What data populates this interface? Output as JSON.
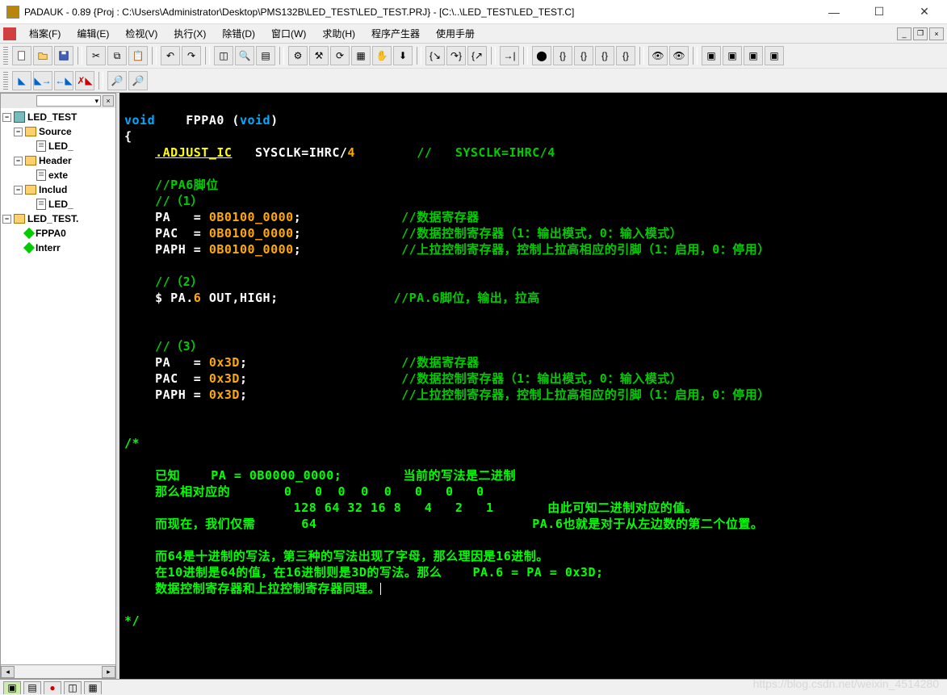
{
  "title": "PADAUK - 0.89 {Proj : C:\\Users\\Administrator\\Desktop\\PMS132B\\LED_TEST\\LED_TEST.PRJ} - [C:\\..\\LED_TEST\\LED_TEST.C]",
  "menu": {
    "file": "档案(F)",
    "edit": "编辑(E)",
    "view": "检视(V)",
    "run": "执行(X)",
    "debug": "除错(D)",
    "window": "窗口(W)",
    "help": "求助(H)",
    "codegen": "程序产生器",
    "manual": "使用手册"
  },
  "tree": {
    "root": "LED_TEST",
    "source": "Source",
    "source_file": "LED_",
    "header": "Header",
    "header_file": "exte",
    "include": "Includ",
    "include_file": "LED_",
    "prj": "LED_TEST.",
    "fn1": "FPPA0",
    "fn2": "Interr"
  },
  "code": {
    "l1a": "void",
    "l1b": "    FPPA0 (",
    "l1c": "void",
    "l1d": ")",
    "l2": "{",
    "l3a": "    ",
    "l3b": ".ADJUST_IC",
    "l3c": "   SYSCLK=IHRC/",
    "l3d": "4",
    "l3e": "        ",
    "l3f": "//   SYSCLK=IHRC/4",
    "l5": "    //PA6脚位",
    "l6": "    //（1）",
    "l7a": "    PA   = ",
    "l7b": "0B0100_0000",
    "l7c": ";",
    "l7pad": "             ",
    "l7d": "//数据寄存器",
    "l8a": "    PAC  = ",
    "l8b": "0B0100_0000",
    "l8c": ";",
    "l8pad": "             ",
    "l8d": "//数据控制寄存器（1：输出模式，0：输入模式）",
    "l9a": "    PAPH = ",
    "l9b": "0B0100_0000",
    "l9c": ";",
    "l9pad": "             ",
    "l9d": "//上拉控制寄存器，控制上拉高相应的引脚（1：启用，0：停用）",
    "l11": "    //（2）",
    "l12a": "    $ PA.",
    "l12b": "6",
    "l12c": " OUT,HIGH;",
    "l12pad": "               ",
    "l12d": "//PA.6脚位，输出，拉高",
    "l15": "    //（3）",
    "l16a": "    PA   = ",
    "l16b": "0x3D",
    "l16c": ";",
    "l16pad": "                    ",
    "l16d": "//数据寄存器",
    "l17a": "    PAC  = ",
    "l17b": "0x3D",
    "l17c": ";",
    "l17pad": "                    ",
    "l17d": "//数据控制寄存器（1：输出模式，0：输入模式）",
    "l18a": "    PAPH = ",
    "l18b": "0x3D",
    "l18c": ";",
    "l18pad": "                    ",
    "l18d": "//上拉控制寄存器，控制上拉高相应的引脚（1：启用，0：停用）",
    "c1": "/*",
    "c3": "    已知    PA = 0B0000_0000;        当前的写法是二进制",
    "c4": "    那么相对应的       0   0  0  0  0   0   0   0",
    "c5": "                      128 64 32 16 8   4   2   1       由此可知二进制对应的值。",
    "c6": "    而现在，我们仅需      64                            PA.6也就是对于从左边数的第二个位置。",
    "c8": "    而64是十进制的写法，第三种的写法出现了字母，那么理因是16进制。",
    "c9": "    在10进制是64的值，在16进制则是3D的写法。那么    PA.6 = PA = 0x3D;",
    "c10": "    数据控制寄存器和上拉控制寄存器同理。",
    "c12": "*/"
  },
  "watermark": "https://blog.csdn.net/weixin_4514280"
}
